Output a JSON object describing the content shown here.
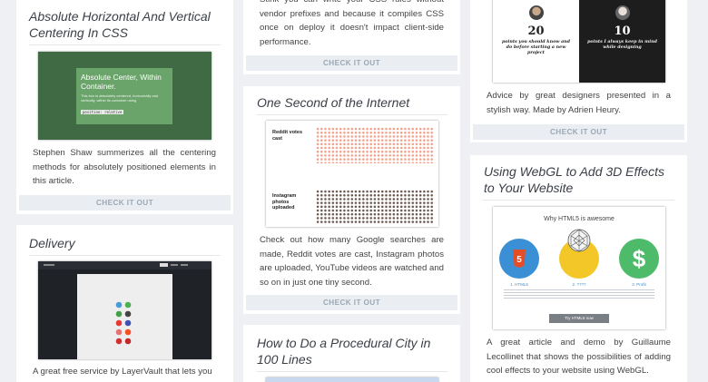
{
  "check_label": "CHECK IT OUT",
  "col1": {
    "card1": {
      "title": "Absolute Horizontal And Vertical Centering In CSS",
      "thumb_heading": "Absolute Center, Within Container.",
      "thumb_body": "This box is absolutely centered, horizontally and vertically, within its container using",
      "thumb_code": "position: relative",
      "desc": "Stephen Shaw summerizes all the centering methods for absolutely positioned elements in this article."
    },
    "card2": {
      "title": "Delivery",
      "desc": "A great free service by LayerVault that lets you"
    }
  },
  "col2": {
    "card0": {
      "desc": "Stink you can write your CSS rules without vendor prefixes and because it compiles CSS once on deploy it doesn't impact client-side performance."
    },
    "card1": {
      "title": "One Second of the Internet",
      "thumb_label1": "Reddit votes cast",
      "thumb_label2": "Instagram photos uploaded",
      "desc": "Check out how many Google searches are made, Reddit votes are cast, Instagram photos are uploaded, YouTube videos are watched and so on in just one tiny second."
    },
    "card2": {
      "title": "How to Do a Procedural City in 100 Lines"
    }
  },
  "col3": {
    "card0": {
      "thumb_num_left": "20",
      "thumb_text_left": "points you should know and do before starting a new project",
      "thumb_num_right": "10",
      "thumb_text_right": "points I always keep in mind while designing",
      "desc": "Advice by great designers presented in a stylish way. Made by Adrien Heury."
    },
    "card1": {
      "title": "Using WebGL to Add 3D Effects to Your Website",
      "thumb_heading": "Why HTML5 is awesome",
      "thumb_items": [
        "1. HTML5",
        "2. ????",
        "3. Profit"
      ],
      "thumb_button": "Try HTML5 now",
      "desc": "A great article and demo by Guillaume Lecollinet that shows the possibilities of adding cool effects to your website using WebGL."
    }
  },
  "colors": {
    "page_bg": "#eef0f3",
    "check_bg": "#eaeef3",
    "check_text": "#9aa7b5",
    "green_thumb": "#3f6a43",
    "html5_blue": "#3b8fd4",
    "yellow": "#f3c728",
    "green_dollar": "#4dbb6a"
  }
}
